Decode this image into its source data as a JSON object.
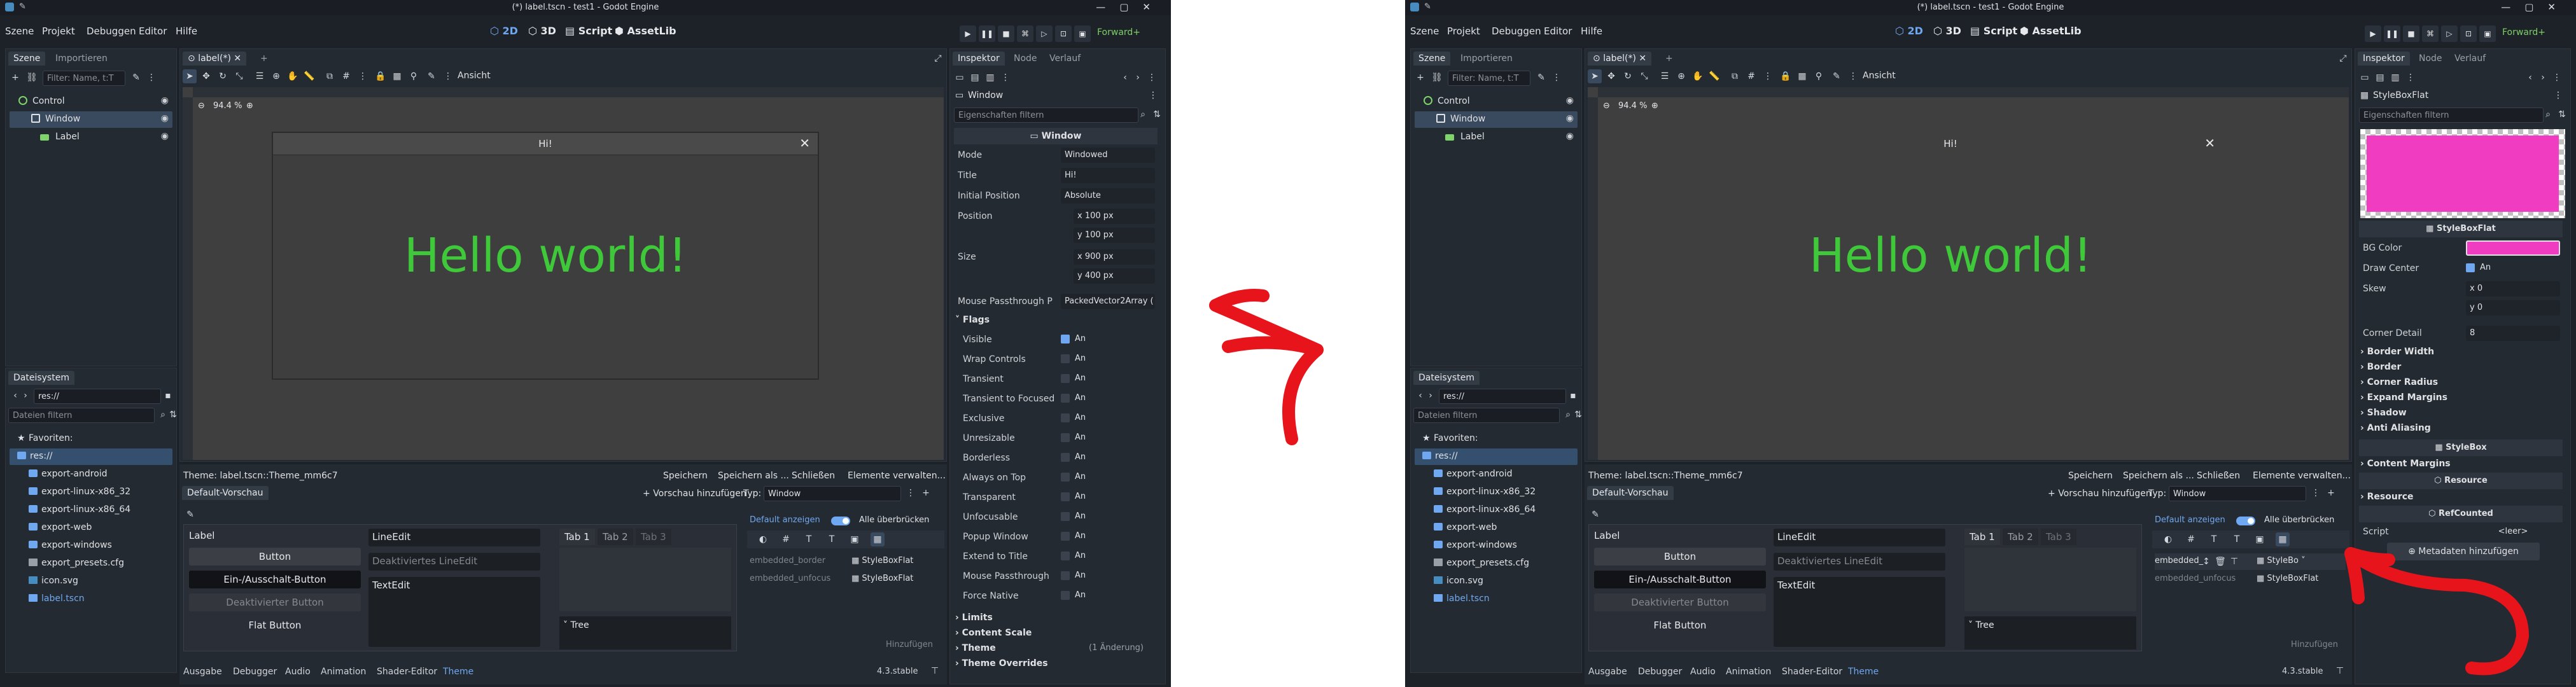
{
  "window_title": "(*) label.tscn - test1 - Godot Engine",
  "menus": [
    "Szene",
    "Projekt",
    "Debuggen",
    "Editor",
    "Hilfe"
  ],
  "workspaces": [
    "2D",
    "3D",
    "Script",
    "AssetLib"
  ],
  "renderer": "Forward+",
  "scene_tabs": [
    "Szene",
    "Importieren"
  ],
  "scene_filter_placeholder": "Filter: Name, t:T",
  "scene_tree": [
    {
      "name": "Control"
    },
    {
      "name": "Window"
    },
    {
      "name": "Label"
    }
  ],
  "editor_tab": "label(*)",
  "view_label": "Ansicht",
  "zoom": "94.4 %",
  "window_node_title": "Hi!",
  "hello_text": "Hello world!",
  "filesystem": {
    "title": "Dateisystem",
    "path": "res://",
    "filter_placeholder": "Dateien filtern",
    "favorites": "Favoriten:",
    "items": [
      "res://",
      "export-android",
      "export-linux-x86_32",
      "export-linux-x86_64",
      "export-web",
      "export-windows",
      "export_presets.cfg",
      "icon.svg",
      "label.tscn"
    ]
  },
  "theme_editor": {
    "title": "Theme: label.tscn::Theme_mm6c7",
    "save": "Speichern",
    "save_as": "Speichern als ...",
    "close": "Schließen",
    "manage_items": "Elemente verwalten...",
    "preview_tab": "Default-Vorschau",
    "add_preview": "Vorschau hinzufügen",
    "type_label": "Typ:",
    "type_value": "Window",
    "show_default": "Default anzeigen",
    "override_all": "Alle überbrücken",
    "controls": {
      "label": "Label",
      "button": "Button",
      "toggle_button": "Ein-/Ausschalt-Button",
      "disabled_button": "Deaktivierter Button",
      "flat_button": "Flat Button",
      "lineedit": "LineEdit",
      "disabled_lineedit": "Deaktiviertes LineEdit",
      "textedit": "TextEdit",
      "tabs": [
        "Tab 1",
        "Tab 2",
        "Tab 3"
      ],
      "tree": "Tree"
    },
    "style_items_left": [
      {
        "name": "embedded_border",
        "value": "StyleBoxFlat"
      },
      {
        "name": "embedded_unfocus",
        "value": "StyleBoxFlat"
      }
    ],
    "style_items_right": [
      {
        "name": "embedded_",
        "value": "StyleBo"
      },
      {
        "name": "embedded_unfocus",
        "value": "StyleBoxFlat"
      }
    ],
    "add_button": "Hinzufügen"
  },
  "bottom_tabs": [
    "Ausgabe",
    "Debugger",
    "Audio",
    "Animation",
    "Shader-Editor",
    "Theme"
  ],
  "version": "4.3.stable",
  "inspector": {
    "tabs": [
      "Inspektor",
      "Node",
      "Verlauf"
    ],
    "filter_placeholder": "Eigenschaften filtern",
    "left": {
      "object": "Window",
      "section": "Window",
      "rows": [
        {
          "key": "Mode",
          "value": "Windowed"
        },
        {
          "key": "Title",
          "value": "Hi!"
        },
        {
          "key": "Initial Position",
          "value": "Absolute"
        }
      ],
      "position_label": "Position",
      "position": {
        "x": "100",
        "y": "100",
        "unit": "px"
      },
      "size_label": "Size",
      "size": {
        "x": "900",
        "y": "400",
        "unit": "px"
      },
      "passthrough_key": "Mouse Passthrough P",
      "passthrough_value": "PackedVector2Array (",
      "flags_label": "Flags",
      "flags": [
        {
          "key": "Visible",
          "on": true
        },
        {
          "key": "Wrap Controls",
          "on": false
        },
        {
          "key": "Transient",
          "on": false
        },
        {
          "key": "Transient to Focused",
          "on": false
        },
        {
          "key": "Exclusive",
          "on": false
        },
        {
          "key": "Unresizable",
          "on": false
        },
        {
          "key": "Borderless",
          "on": false
        },
        {
          "key": "Always on Top",
          "on": false
        },
        {
          "key": "Transparent",
          "on": false
        },
        {
          "key": "Unfocusable",
          "on": false
        },
        {
          "key": "Popup Window",
          "on": false
        },
        {
          "key": "Extend to Title",
          "on": false
        },
        {
          "key": "Mouse Passthrough",
          "on": false
        },
        {
          "key": "Force Native",
          "on": false
        }
      ],
      "on_label": "An",
      "groups": [
        "Limits",
        "Content Scale",
        "Theme",
        "Theme Overrides"
      ],
      "theme_note": "(1 Änderung)"
    },
    "right": {
      "object": "StyleBoxFlat",
      "preview_label": "StyleBoxFlat",
      "preview_color": "#f03cc0",
      "bg_color_label": "BG Color",
      "draw_center_label": "Draw Center",
      "skew_label": "Skew",
      "skew": {
        "x": "0",
        "y": "0"
      },
      "corner_detail_label": "Corner Detail",
      "corner_detail": "8",
      "groups": [
        "Border Width",
        "Border",
        "Corner Radius",
        "Expand Margins",
        "Shadow",
        "Anti Aliasing"
      ],
      "section_stylebox": "StyleBox",
      "group_content_margins": "Content Margins",
      "section_resource": "Resource",
      "group_resource": "Resource",
      "section_refcounted": "RefCounted",
      "script_label": "Script",
      "script_value": "<leer>",
      "add_metadata": "Metadaten hinzufügen"
    }
  },
  "colors": {
    "annotation_arrow": "#e8141c",
    "label_green": "#3ec83a",
    "accent": "#6fa8f0"
  }
}
